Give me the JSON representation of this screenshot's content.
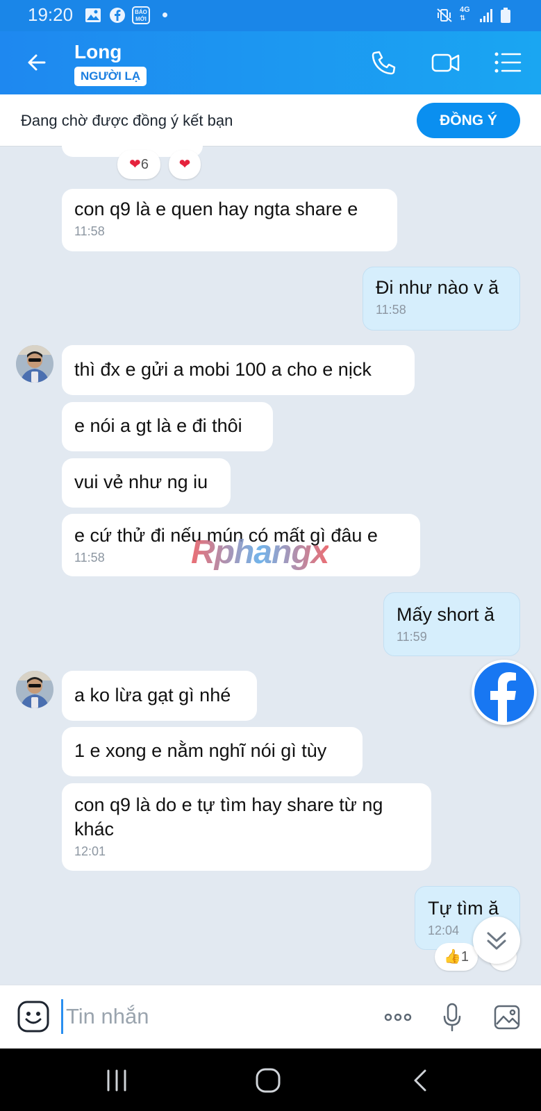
{
  "status_bar": {
    "time": "19:20",
    "baomoi_label": "BÁO MỚI",
    "network": "4G"
  },
  "header": {
    "contact_name": "Long",
    "badge": "NGƯỜI LẠ"
  },
  "friend_request": {
    "text": "Đang chờ được đồng ý kết bạn",
    "accept_label": "ĐỒNG Ý"
  },
  "top_reactions": {
    "heart_count": "6"
  },
  "messages": [
    {
      "text": "con q9 là e quen hay ngta share e",
      "time": "11:58"
    },
    {
      "text": "Đi như nào v ă",
      "time": "11:58"
    },
    {
      "text": "thì đx e gửi a mobi 100 a cho e nịck"
    },
    {
      "text": "e nói a gt là e đi thôi"
    },
    {
      "text": "vui vẻ như ng iu"
    },
    {
      "text": "e cứ thử đi nếu mún có mất gì đâu e",
      "time": "11:58"
    },
    {
      "text": "Mấy short ă",
      "time": "11:59"
    },
    {
      "text": "a ko lừa gạt gì nhé"
    },
    {
      "text": "1 e xong e nằm nghĩ nói gì tùy"
    },
    {
      "text": "con q9 là do e tự tìm hay share từ ng khác",
      "time": "12:01"
    },
    {
      "text": "Tự tìm ă",
      "time": "12:04"
    }
  ],
  "last_reaction": {
    "like_count": "1"
  },
  "watermark": "Rphangx",
  "input": {
    "placeholder": "Tin nhắn"
  },
  "colors": {
    "header": "#1e88f0",
    "accent": "#0a8ff0",
    "my_bubble": "#d6eefc",
    "chat_bg": "#e2e9f1"
  }
}
